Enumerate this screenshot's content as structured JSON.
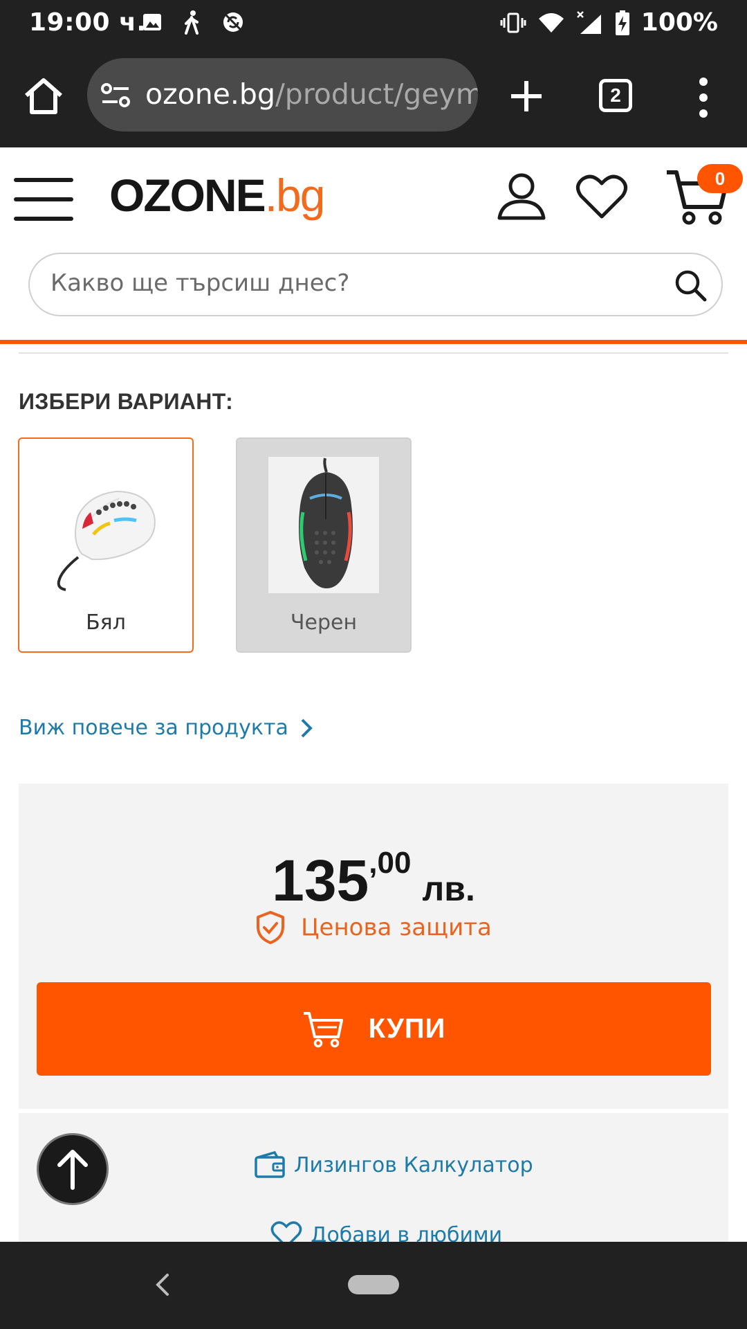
{
  "status_bar": {
    "time": "19:00 ч.",
    "battery": "100%",
    "icons": [
      "image-icon",
      "walking-icon",
      "no-sync-icon",
      "vibrate-icon",
      "wifi-icon",
      "signal-icon",
      "battery-charging-icon"
    ]
  },
  "browser": {
    "url_host": "ozone.bg",
    "url_path": "/product/geymi",
    "tab_count": "2"
  },
  "site": {
    "logo_main": "OZONE",
    "logo_tld": ".bg",
    "cart_count": "0",
    "search_placeholder": "Какво ще търсиш днес?"
  },
  "variants": {
    "title": "ИЗБЕРИ ВАРИАНТ:",
    "items": [
      {
        "label": "Бял",
        "selected": true
      },
      {
        "label": "Черен",
        "selected": false
      }
    ]
  },
  "product": {
    "more_link": "Виж повече за продукта",
    "price_int": "135",
    "price_dec": ",00",
    "currency": "лв.",
    "protection": "Ценова защита",
    "buy_label": "КУПИ",
    "leasing_link": "Лизингов Калкулатор",
    "favorite_link": "Добави в любими"
  },
  "colors": {
    "accent": "#ff5500",
    "link": "#1e7aa8",
    "dark_bar": "#212121"
  }
}
